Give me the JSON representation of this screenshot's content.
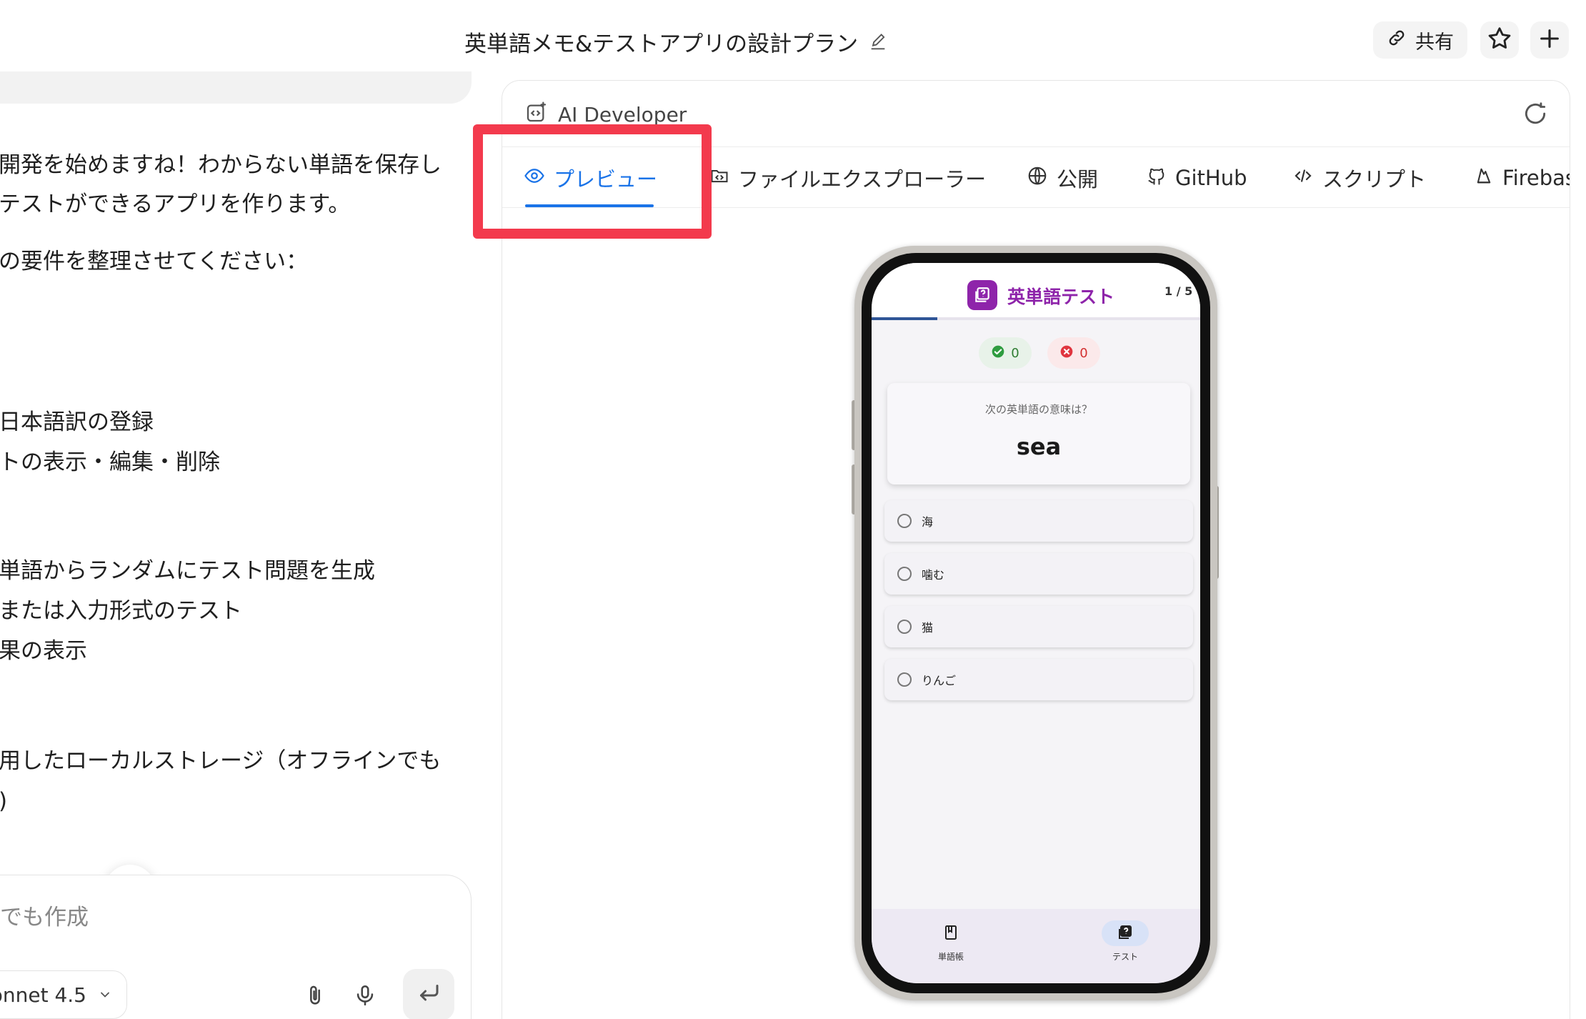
{
  "header": {
    "title": "英単語メモ&テストアプリの設計プラン",
    "share_label": "共有"
  },
  "chat": {
    "lines": [
      "開発を始めますね！わからない単語を保存し",
      "テストができるアプリを作ります。",
      "の要件を整理させてください：",
      "日本語訳の登録",
      "トの表示・編集・削除",
      "単語からランダムにテスト問題を生成",
      "または入力形式のテスト",
      "果の表示",
      "用したローカルストレージ（オフラインでも",
      ")"
    ],
    "composer_placeholder": "でも作成",
    "model_label": "onnet 4.5"
  },
  "workspace": {
    "title": "AI Developer",
    "tabs": [
      {
        "label": "プレビュー",
        "icon": "eye-icon",
        "active": true
      },
      {
        "label": "ファイルエクスプローラー",
        "icon": "folder-code-icon",
        "active": false
      },
      {
        "label": "公開",
        "icon": "globe-icon",
        "active": false
      },
      {
        "label": "GitHub",
        "icon": "github-icon",
        "active": false
      },
      {
        "label": "スクリプト",
        "icon": "code-icon",
        "active": false
      },
      {
        "label": "Firebas",
        "icon": "firebase-icon",
        "active": false
      }
    ]
  },
  "app": {
    "title": "英単語テスト",
    "progress_text": "1 / 5",
    "progress_fraction": 0.2,
    "correct_count": "0",
    "wrong_count": "0",
    "question_prompt": "次の英単語の意味は？",
    "question_word": "sea",
    "options": [
      "海",
      "噛む",
      "猫",
      "りんご"
    ],
    "nav": [
      {
        "label": "単語帳",
        "icon": "book-icon",
        "active": false
      },
      {
        "label": "テスト",
        "icon": "quiz-icon",
        "active": true
      }
    ]
  },
  "colors": {
    "accent": "#1a73e8",
    "highlight": "#f33a4d",
    "app_brand": "#8e24aa",
    "correct": "#2e7d32",
    "wrong": "#d32f2f"
  }
}
